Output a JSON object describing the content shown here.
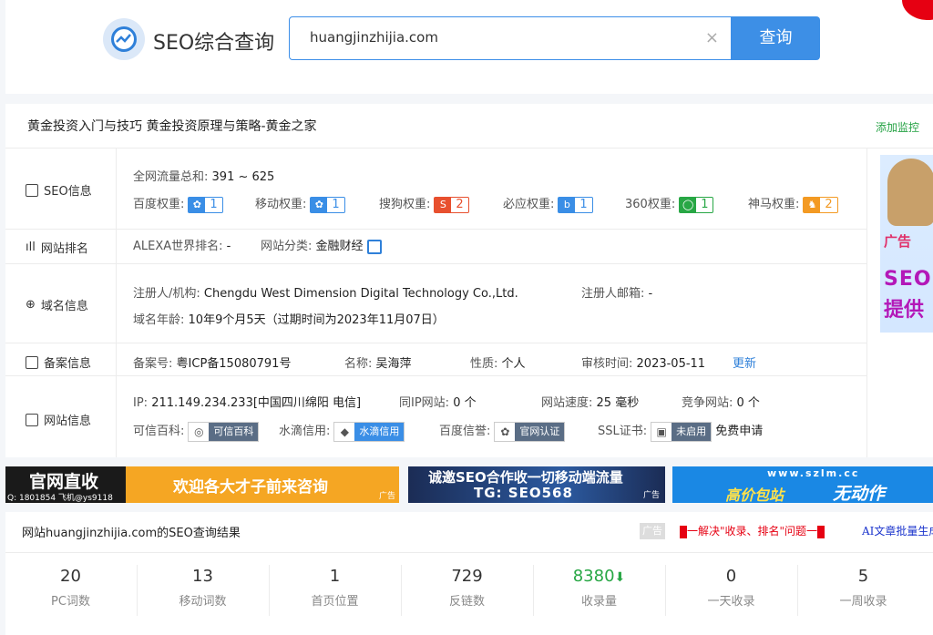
{
  "header": {
    "title": "SEO综合查询",
    "search_value": "huangjinzhijia.com",
    "clear_icon": "×",
    "search_button": "查询"
  },
  "site": {
    "title": "黄金投资入门与技巧 黄金投资原理与策略-黄金之家",
    "add_monitor": "添加监控"
  },
  "seo_info": {
    "label": "SEO信息",
    "traffic_label": "全网流量总和:",
    "traffic_value": "391 ~ 625",
    "weights": [
      {
        "label": "百度权重:",
        "value": "1",
        "color": "#3a8ee6",
        "icon": "paw"
      },
      {
        "label": "移动权重:",
        "value": "1",
        "color": "#3a8ee6",
        "icon": "paw"
      },
      {
        "label": "搜狗权重:",
        "value": "2",
        "color": "#e8502f",
        "icon": "S"
      },
      {
        "label": "必应权重:",
        "value": "1",
        "color": "#3a8ee6",
        "icon": "b"
      },
      {
        "label": "360权重:",
        "value": "1",
        "color": "#28a745",
        "icon": "ring"
      },
      {
        "label": "神马权重:",
        "value": "2",
        "color": "#f39a23",
        "icon": "horse"
      }
    ]
  },
  "rank": {
    "label": "网站排名",
    "alexa_label": "ALEXA世界排名:",
    "alexa_value": "-",
    "category_label": "网站分类:",
    "category_value": "金融财经"
  },
  "domain": {
    "label": "域名信息",
    "registrant_label": "注册人/机构:",
    "registrant_value": "Chengdu West Dimension Digital Technology Co.,Ltd.",
    "email_label": "注册人邮箱:",
    "email_value": "-",
    "age_label": "域名年龄:",
    "age_value": "10年9个月5天（过期时间为2023年11月07日）"
  },
  "beian": {
    "label": "备案信息",
    "number_label": "备案号:",
    "number_value": "粤ICP备15080791号",
    "name_label": "名称:",
    "name_value": "吴海萍",
    "nature_label": "性质:",
    "nature_value": "个人",
    "review_label": "审核时间:",
    "review_value": "2023-05-11",
    "update_link": "更新"
  },
  "siteinfo": {
    "label": "网站信息",
    "ip_label": "IP:",
    "ip_value": "211.149.234.233[中国四川绵阳 电信]",
    "same_ip_label": "同IP网站:",
    "same_ip_value": "0 个",
    "speed_label": "网站速度:",
    "speed_value": "25 毫秒",
    "compete_label": "竞争网站:",
    "compete_value": "0 个",
    "kexin_label": "可信百科:",
    "kexin_pill": "可信百科",
    "shuidi_label": "水滴信用:",
    "shuidi_pill": "水滴信用",
    "baidu_label": "百度信誉:",
    "baidu_pill": "官网认证",
    "ssl_label": "SSL证书:",
    "ssl_pill": "未启用",
    "ssl_free": "免费申请"
  },
  "side_ad": {
    "line1": "广告",
    "line2": "SEO",
    "line3": "提供"
  },
  "banners": {
    "b1_big": "官网直收",
    "b1_small": "Q: 1801854 飞机@ys9118",
    "b1_mid": "欢迎各大才子前来咨询",
    "b1_tag": "广告",
    "b2_line1": "诚邀SEO合作收一切移动端流量",
    "b2_line2": "TG: SEO568",
    "b2_tag": "广告",
    "b3_url": "www.szlm.cc",
    "b3_a": "高价包站",
    "b3_b": "无动作"
  },
  "result": {
    "title": "网站huangjinzhijia.com的SEO查询结果",
    "ad_tag": "广告",
    "ad_red": "一解决\"收录、排名\"问题一",
    "ad_blue": "AI文章批量生成",
    "stats": [
      {
        "value": "20",
        "label": "PC词数"
      },
      {
        "value": "13",
        "label": "移动词数"
      },
      {
        "value": "1",
        "label": "首页位置"
      },
      {
        "value": "729",
        "label": "反链数"
      },
      {
        "value": "8380",
        "label": "收录量",
        "arrow": "⬇"
      },
      {
        "value": "0",
        "label": "一天收录"
      },
      {
        "value": "5",
        "label": "一周收录"
      }
    ]
  }
}
